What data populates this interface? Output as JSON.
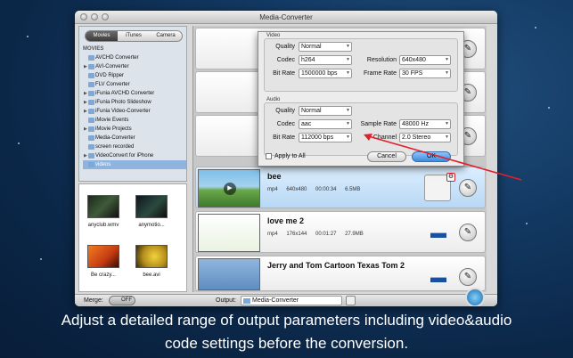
{
  "window": {
    "title": "Media-Converter"
  },
  "sidebar": {
    "tabs": [
      "Movies",
      "iTunes",
      "Camera"
    ],
    "section_header": "MOVIES",
    "items": [
      {
        "label": "AVCHD Converter",
        "arrow": ""
      },
      {
        "label": "AVI-Converter",
        "arrow": "▶"
      },
      {
        "label": "DVD Ripper",
        "arrow": ""
      },
      {
        "label": "FLV Converter",
        "arrow": ""
      },
      {
        "label": "iFunia AVCHD Converter",
        "arrow": "▶"
      },
      {
        "label": "iFunia Photo Slideshow",
        "arrow": "▶"
      },
      {
        "label": "iFunia Video-Converter",
        "arrow": "▶"
      },
      {
        "label": "iMovie Events",
        "arrow": ""
      },
      {
        "label": "iMovie Projects",
        "arrow": "▶"
      },
      {
        "label": "Media-Converter",
        "arrow": ""
      },
      {
        "label": "screen recorded",
        "arrow": ""
      },
      {
        "label": "VideoConvert for iPhone",
        "arrow": "▶"
      },
      {
        "label": "videos",
        "arrow": ""
      }
    ]
  },
  "thumbnails": [
    {
      "name": "anyclub.wmv"
    },
    {
      "name": "anymotio..."
    },
    {
      "name": "Be crazy..."
    },
    {
      "name": "bee.avi"
    }
  ],
  "dialog": {
    "video_header": "Video",
    "audio_header": "Audio",
    "video": {
      "quality_label": "Quality",
      "quality": "Normal",
      "codec_label": "Codec",
      "codec": "h264",
      "resolution_label": "Resolution",
      "resolution": "640x480",
      "bitrate_label": "Bit Rate",
      "bitrate": "1500000 bps",
      "framerate_label": "Frame Rate",
      "framerate": "30 FPS"
    },
    "audio": {
      "quality_label": "Quality",
      "quality": "Normal",
      "codec_label": "Codec",
      "codec": "aac",
      "samplerate_label": "Sample Rate",
      "samplerate": "48000 Hz",
      "bitrate_label": "Bit Rate",
      "bitrate": "112000 bps",
      "channel_label": "Channel",
      "channel": "2.0 Stereo"
    },
    "apply_all": "Apply to All",
    "cancel": "Cancel",
    "ok": "OK"
  },
  "files": [
    {
      "name": "bee",
      "format": "mp4",
      "resolution": "640x480",
      "duration": "00:00:34",
      "size": "6.5MB"
    },
    {
      "name": "love me 2",
      "format": "mp4",
      "resolution": "176x144",
      "duration": "00:01:27",
      "size": "27.9MB"
    },
    {
      "name": "Jerry and Tom Cartoon Texas Tom 2"
    }
  ],
  "bottom": {
    "merge_label": "Merge:",
    "merge_state": "OFF",
    "output_label": "Output:",
    "output_value": "Media-Converter"
  },
  "caption": {
    "line1": "Adjust a detailed range of output parameters including video&audio",
    "line2": "code settings before the conversion."
  },
  "colors": {
    "selected_row": "#b9d8f4",
    "ok_button": "#3b8ce0",
    "annotation": "#e0202a"
  }
}
